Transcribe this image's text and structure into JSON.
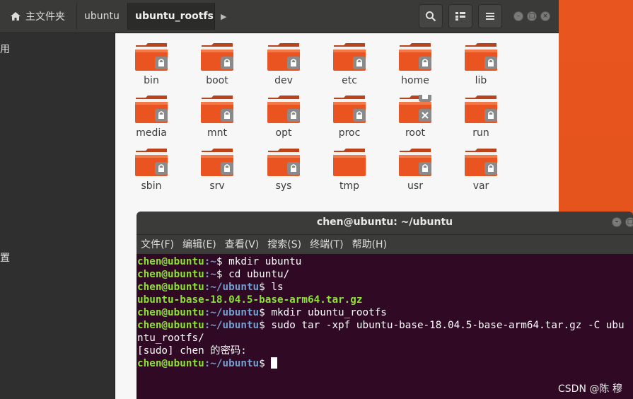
{
  "file_manager": {
    "breadcrumbs": [
      {
        "label": "主文件夹"
      },
      {
        "label": "ubuntu"
      },
      {
        "label": "ubuntu_rootfs"
      }
    ],
    "sidebar_partial": {
      "item_top": "用",
      "item_bottom": "置"
    },
    "items": [
      {
        "name": "bin",
        "locked": true
      },
      {
        "name": "boot",
        "locked": true
      },
      {
        "name": "dev",
        "locked": true
      },
      {
        "name": "etc",
        "locked": true
      },
      {
        "name": "home",
        "locked": true
      },
      {
        "name": "lib",
        "locked": true
      },
      {
        "name": "media",
        "locked": true
      },
      {
        "name": "mnt",
        "locked": true
      },
      {
        "name": "opt",
        "locked": true
      },
      {
        "name": "proc",
        "locked": true
      },
      {
        "name": "root",
        "locked": true,
        "no_access": true
      },
      {
        "name": "run",
        "locked": true
      },
      {
        "name": "sbin",
        "locked": true
      },
      {
        "name": "srv",
        "locked": true
      },
      {
        "name": "sys",
        "locked": true
      },
      {
        "name": "tmp",
        "locked": false
      },
      {
        "name": "usr",
        "locked": true
      },
      {
        "name": "var",
        "locked": true
      }
    ]
  },
  "terminal": {
    "title": "chen@ubuntu: ~/ubuntu",
    "menu": [
      "文件(F)",
      "编辑(E)",
      "查看(V)",
      "搜索(S)",
      "终端(T)",
      "帮助(H)"
    ],
    "lines": [
      {
        "user": "chen@ubuntu",
        "path": ":~",
        "cmd": "$ mkdir ubuntu"
      },
      {
        "user": "chen@ubuntu",
        "path": ":~",
        "cmd": "$ cd ubuntu/"
      },
      {
        "user": "chen@ubuntu",
        "path": ":~/ubuntu",
        "cmd": "$ ls"
      },
      {
        "output_green": "ubuntu-base-18.04.5-base-arm64.tar.gz"
      },
      {
        "user": "chen@ubuntu",
        "path": ":~/ubuntu",
        "cmd": "$ mkdir ubuntu_rootfs"
      },
      {
        "user": "chen@ubuntu",
        "path": ":~/ubuntu",
        "cmd": "$ sudo tar -xpf ubuntu-base-18.04.5-base-arm64.tar.gz -C ubu"
      },
      {
        "output": "ntu_rootfs/"
      },
      {
        "output": "[sudo] chen 的密码:"
      },
      {
        "user": "chen@ubuntu",
        "path": ":~/ubuntu",
        "cmd": "$ ",
        "cursor": true
      }
    ]
  },
  "watermark": "CSDN @陈 穆",
  "colors": {
    "folder": "#e95420",
    "terminal_bg": "#300a24",
    "prompt_user": "#8ae234",
    "prompt_path": "#729fcf"
  }
}
